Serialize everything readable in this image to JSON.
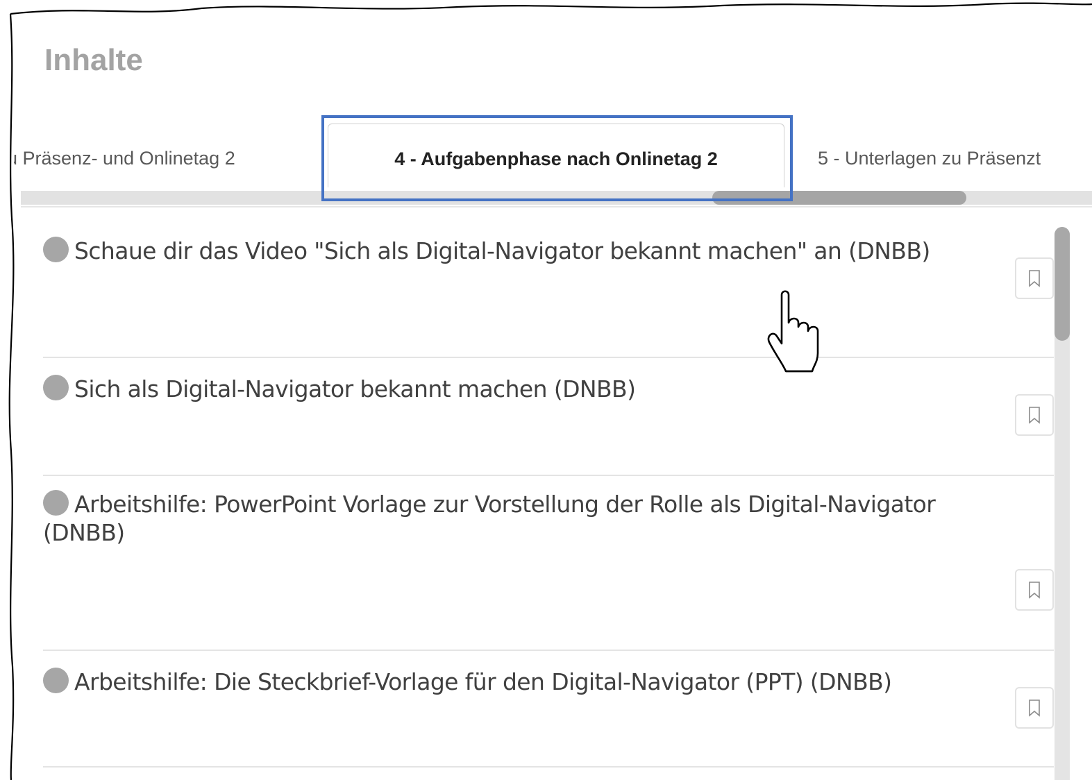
{
  "page": {
    "title": "Inhalte"
  },
  "tabs": [
    {
      "label": "u Präsenz- und Onlinetag 2",
      "active": false
    },
    {
      "label": "4 - Aufgabenphase nach Onlinetag 2",
      "active": true
    },
    {
      "label": "5 - Unterlagen zu Präsenzt",
      "active": false
    }
  ],
  "items": [
    {
      "title": "Schaue dir das Video \"Sich als Digital-Navigator bekannt machen\" an (DNBB)",
      "status": "not-completed",
      "bookmark_icon": "bookmark-icon"
    },
    {
      "title": "Sich als Digital-Navigator bekannt machen (DNBB)",
      "status": "not-completed",
      "bookmark_icon": "bookmark-icon"
    },
    {
      "title": "Arbeitshilfe: PowerPoint Vorlage zur Vorstellung der Rolle als Digital-Navigator (DNBB)",
      "status": "not-completed",
      "bookmark_icon": "bookmark-icon"
    },
    {
      "title": "Arbeitshilfe: Die Steckbrief-Vorlage für den Digital-Navigator (PPT) (DNBB)",
      "status": "not-completed",
      "bookmark_icon": "bookmark-icon"
    }
  ],
  "colors": {
    "highlight": "#4472c4",
    "title": "#a3a3a3",
    "status_dot": "#a6a6a6"
  }
}
